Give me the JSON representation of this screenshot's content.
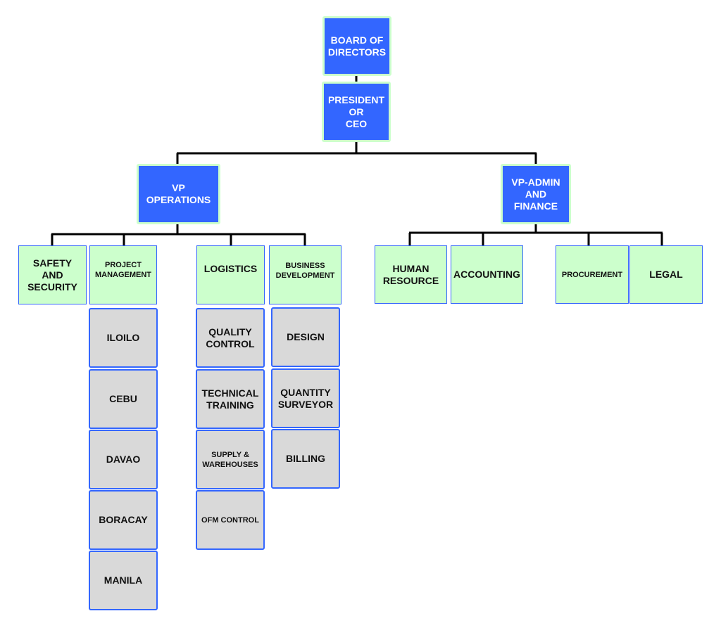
{
  "colors": {
    "executive_fill": "#3366ff",
    "executive_border": "#ccffcc",
    "department_fill": "#ccffcc",
    "unit_fill": "#d9d9d9",
    "box_border": "#3366ff",
    "connector": "#000000"
  },
  "executives": {
    "board": "BOARD OF\nDIRECTORS",
    "president": "PRESIDENT\nOR\nCEO",
    "vp_operations": "VP\nOPERATIONS",
    "vp_admin_finance": "VP-ADMIN\nAND\nFINANCE"
  },
  "operations_departments": {
    "safety": "SAFETY\nAND\nSECURITY",
    "project_management": "PROJECT\nMANAGEMENT",
    "logistics": "LOGISTICS",
    "business_development": "BUSINESS\nDEVELOPMENT"
  },
  "admin_departments": {
    "human_resource": "HUMAN\nRESOURCE",
    "accounting": "ACCOUNTING",
    "procurement": "PROCUREMENT",
    "legal": "LEGAL"
  },
  "project_management_units": [
    "ILOILO",
    "CEBU",
    "DAVAO",
    "BORACAY",
    "MANILA"
  ],
  "logistics_units": [
    "QUALITY\nCONTROL",
    "TECHNICAL\nTRAINING",
    "SUPPLY &\nWAREHOUSES",
    "OFM CONTROL"
  ],
  "business_development_units": [
    "DESIGN",
    "QUANTITY\nSURVEYOR",
    "BILLING"
  ]
}
